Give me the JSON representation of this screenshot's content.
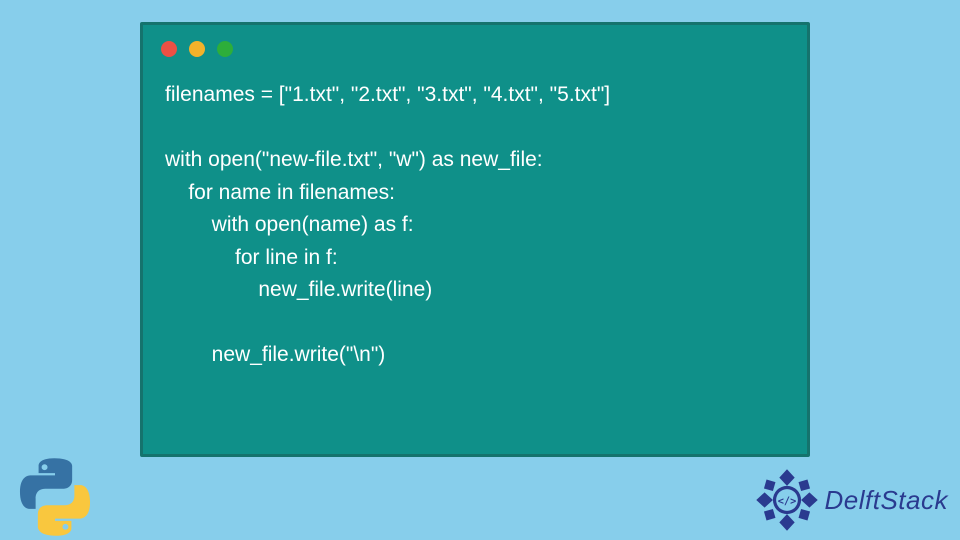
{
  "code": {
    "lines": [
      "filenames = [\"1.txt\", \"2.txt\", \"3.txt\", \"4.txt\", \"5.txt\"]",
      "",
      "with open(\"new-file.txt\", \"w\") as new_file:",
      "    for name in filenames:",
      "        with open(name) as f:",
      "            for line in f:",
      "                new_file.write(line)",
      "",
      "        new_file.write(\"\\n\")"
    ]
  },
  "brand": {
    "name": "DelftStack"
  },
  "colors": {
    "page_bg": "#87ceeb",
    "window_bg": "#0f9089",
    "window_border": "#15736d",
    "text": "#ffffff",
    "red": "#ec5044",
    "yellow": "#f3b22a",
    "green": "#2dae3a",
    "brand_text": "#2a3a8f"
  }
}
